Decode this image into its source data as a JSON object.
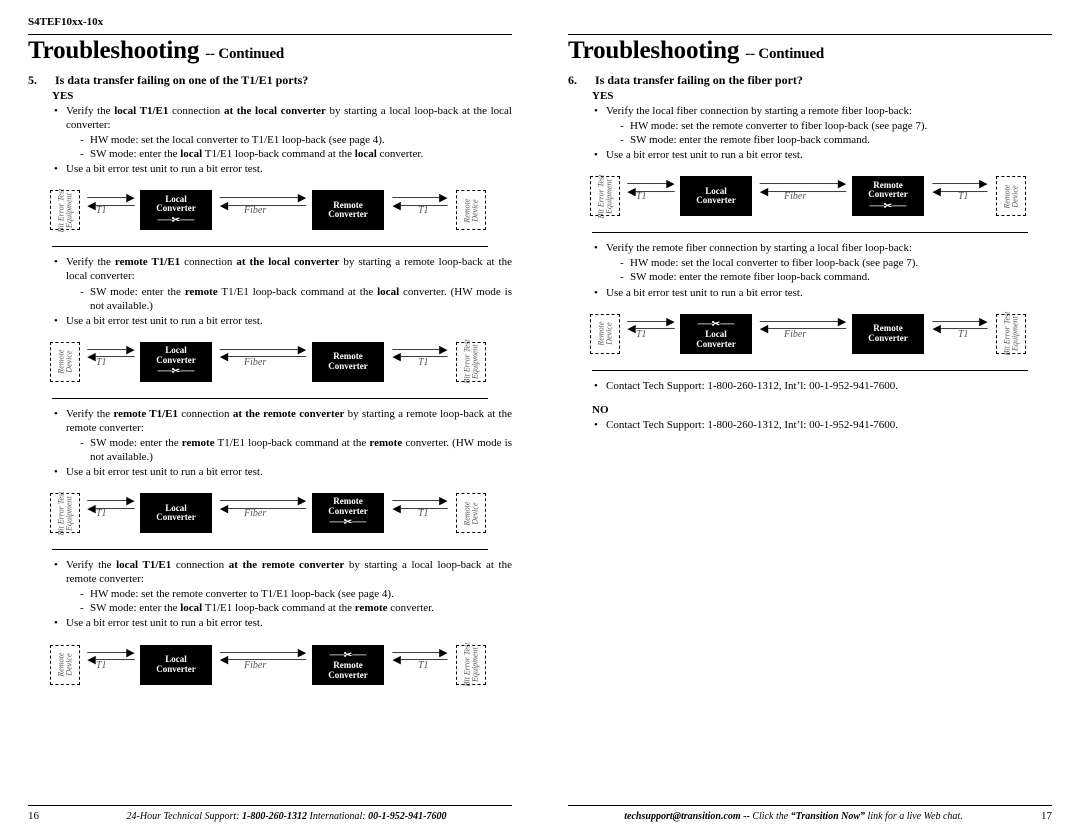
{
  "doc": {
    "running_head": "S4TEF10xx-10x",
    "section_title": "Troubleshooting",
    "section_suffix": "-- Continued"
  },
  "left": {
    "q_num": "5.",
    "q_text": "Is data transfer failing on one of the T1/E1 ports?",
    "yes": "YES",
    "blocks": [
      {
        "bullet1_pre": "Verify the ",
        "bullet1_b1": "local T1/E1",
        "bullet1_mid": " connection ",
        "bullet1_b2": "at the local converter",
        "bullet1_post": " by starting a local loop-back at the local converter:",
        "sub1": "HW mode: set the local converter to T1/E1 loop-back (see page 4).",
        "sub2_pre": "SW mode: enter the ",
        "sub2_b1": "local",
        "sub2_mid": " T1/E1 loop-back command at the ",
        "sub2_b2": "local",
        "sub2_post": " converter.",
        "bullet2": "Use a bit error test unit to run a bit error test.",
        "diag": {
          "left_end": "Bit Error Test\nEquipment",
          "right_end": "Remote\nDevice",
          "scissor_on": "local"
        }
      },
      {
        "bullet1_pre": "Verify the ",
        "bullet1_b1": "remote T1/E1",
        "bullet1_mid": " connection ",
        "bullet1_b2": "at the local converter",
        "bullet1_post": " by starting a remote loop-back at the local converter:",
        "sub1": "",
        "sub2_pre": "SW mode: enter the ",
        "sub2_b1": "remote",
        "sub2_mid": " T1/E1 loop-back command at the ",
        "sub2_b2": "local",
        "sub2_post": " converter.  (HW mode is not available.)",
        "bullet2": "Use a bit error test unit to run a bit error test.",
        "diag": {
          "left_end": "Remote\nDevice",
          "right_end": "Bit Error Test\nEquipment",
          "scissor_on": "local"
        }
      },
      {
        "bullet1_pre": "Verify the ",
        "bullet1_b1": "remote T1/E1",
        "bullet1_mid": " connection ",
        "bullet1_b2": "at the remote converter",
        "bullet1_post": " by starting a remote loop-back at the remote converter:",
        "sub1": "",
        "sub2_pre": "SW mode: enter the ",
        "sub2_b1": "remote",
        "sub2_mid": " T1/E1 loop-back command at the ",
        "sub2_b2": "remote",
        "sub2_post": " converter.  (HW mode is not available.)",
        "bullet2": "Use a bit error test unit to run a bit error test.",
        "diag": {
          "left_end": "Bit Error Test\nEquipment",
          "right_end": "Remote\nDevice",
          "scissor_on": "remote"
        }
      },
      {
        "bullet1_pre": "Verify the ",
        "bullet1_b1": "local T1/E1",
        "bullet1_mid": " connection ",
        "bullet1_b2": "at the remote converter",
        "bullet1_post": " by starting a local loop-back at the remote converter:",
        "sub1": "HW mode: set the remote converter to T1/E1 loop-back (see page 4).",
        "sub2_pre": "SW mode: enter the ",
        "sub2_b1": "local",
        "sub2_mid": " T1/E1 loop-back command at the ",
        "sub2_b2": "remote",
        "sub2_post": " converter.",
        "bullet2": "Use a bit error test unit to run a bit error test.",
        "diag": {
          "left_end": "Remote\nDevice",
          "right_end": "Bit Error Test\nEquipment",
          "scissor_on": "remote"
        }
      }
    ],
    "labels": {
      "t1": "T1",
      "fiber": "Fiber",
      "local_conv": "Local\nConverter",
      "remote_conv": "Remote\nConverter"
    }
  },
  "right": {
    "q_num": "6.",
    "q_text": "Is data transfer failing on the fiber port?",
    "yes": "YES",
    "no": "NO",
    "block1": {
      "bullet1": "Verify the local fiber connection by starting a remote fiber loop-back:",
      "sub1": "HW mode: set the remote converter to fiber loop-back (see page 7).",
      "sub2": "SW mode: enter the remote fiber loop-back command.",
      "bullet2": "Use a bit error test unit to run a bit error test.",
      "diag": {
        "left_end": "Bit Error Test\nEquipment",
        "right_end": "Remote\nDevice",
        "scissor_on": "remote"
      }
    },
    "block2": {
      "bullet1": "Verify the remote fiber connection by starting a local fiber loop-back:",
      "sub1": "HW mode: set the local converter to fiber loop-back (see page 7).",
      "sub2": "SW mode: enter the remote fiber loop-back command.",
      "bullet2": "Use a bit error test unit to run a bit error test.",
      "diag": {
        "left_end": "Remote\nDevice",
        "right_end": "Bit Error Test\nEquipment",
        "scissor_on": "local"
      }
    },
    "contact_yes": "Contact Tech Support: 1-800-260-1312, Int’l: 00-1-952-941-7600.",
    "contact_no": "Contact Tech Support: 1-800-260-1312, Int’l: 00-1-952-941-7600."
  },
  "footer": {
    "left_page_num": "16",
    "right_page_num": "17",
    "left_text_pre": "24-Hour Technical Support: ",
    "left_phone1": "1-800-260-1312",
    "left_text_mid": "  International: ",
    "left_phone2": "00-1-952-941-7600",
    "right_text_pre": "techsupport@transition.com -- ",
    "right_text_mid1": "Click the ",
    "right_link": "“Transition Now”",
    "right_text_mid2": " link for a live Web chat."
  }
}
